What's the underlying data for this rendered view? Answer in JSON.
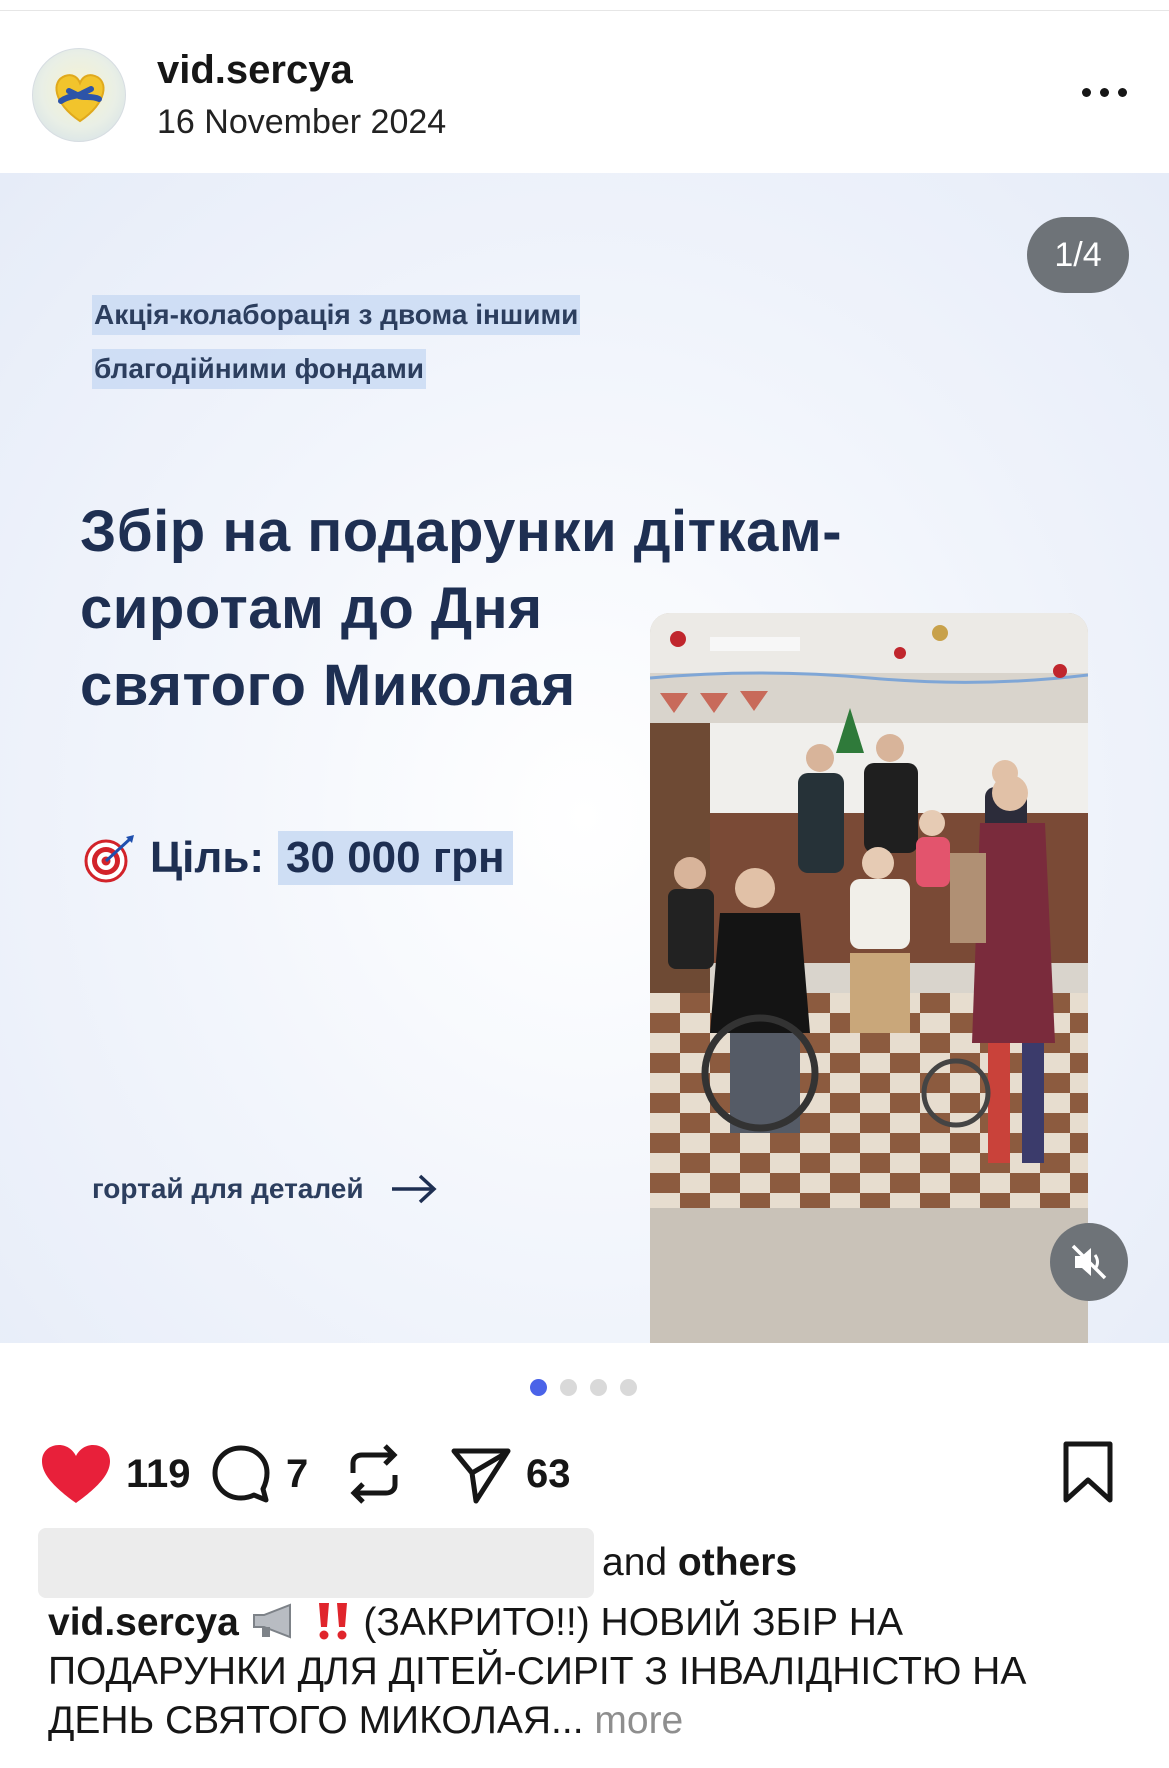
{
  "post": {
    "username": "vid.sercya",
    "date": "16 November 2024",
    "more_icon": "more-horizontal-icon"
  },
  "slide": {
    "counter": "1/4",
    "tag_line_1": "Акція-колаборація з двома іншими",
    "tag_line_2": "благодійними фондами",
    "headline_line_1": "Збір на подарунки діткам-",
    "headline_line_2": "сиротам до Дня",
    "headline_line_3": "святого Миколая",
    "goal_label": "Ціль:",
    "goal_value": "30 000 грн",
    "scroll_hint": "гортай для деталей",
    "colors": {
      "headline": "#1e2f52",
      "highlight": "#cadaf3"
    }
  },
  "pagination": {
    "total": 4,
    "active": 1,
    "active_color": "#4a63e8"
  },
  "actions": {
    "likes": "119",
    "comments": "7",
    "shares": "63",
    "like_color": "#e8203a"
  },
  "liked_by": {
    "suffix": "and",
    "others": "others"
  },
  "caption": {
    "username": "vid.sercya",
    "text_1": "(ЗАКРИТО!!) НОВИЙ ЗБІР НА",
    "text_2": "ПОДАРУНКИ ДЛЯ ДІТЕЙ-СИРІТ З ІНВАЛІДНІСТЮ НА",
    "text_3": "ДЕНЬ СВЯТОГО МИКОЛАЯ...",
    "more": "more"
  }
}
